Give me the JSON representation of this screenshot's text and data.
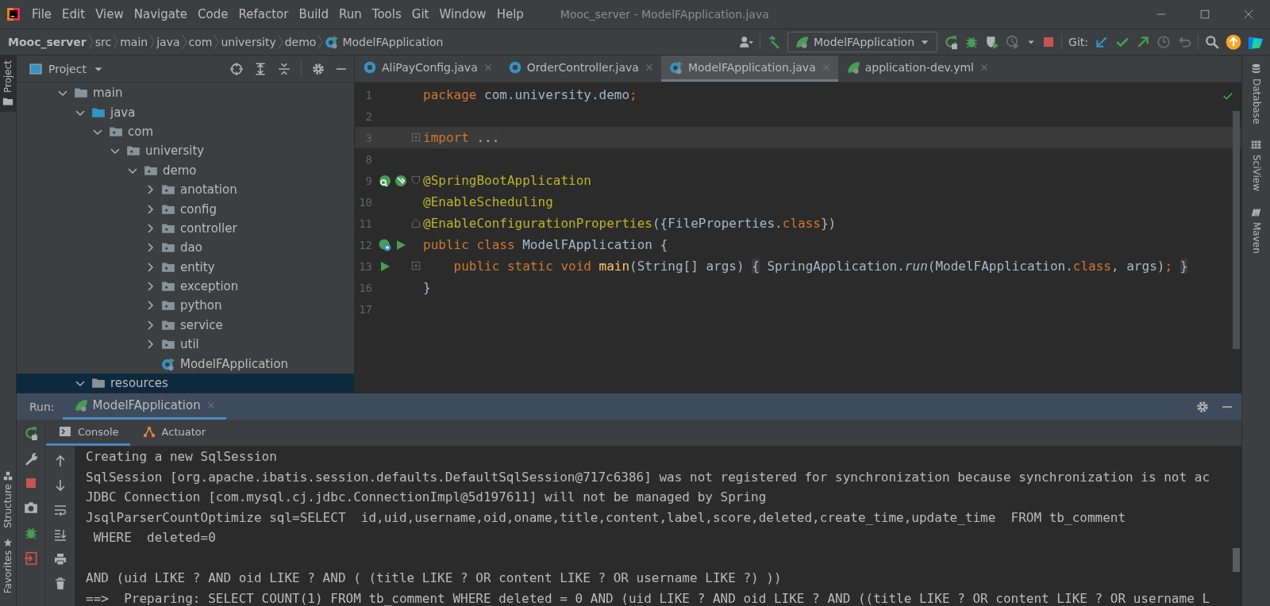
{
  "window": {
    "title": "Mooc_server - ModelFApplication.java"
  },
  "menu": [
    "File",
    "Edit",
    "View",
    "Navigate",
    "Code",
    "Refactor",
    "Build",
    "Run",
    "Tools",
    "Git",
    "Window",
    "Help"
  ],
  "breadcrumbs": [
    {
      "label": "Mooc_server",
      "kind": "project"
    },
    {
      "label": "src",
      "kind": "dir"
    },
    {
      "label": "main",
      "kind": "dir"
    },
    {
      "label": "java",
      "kind": "dir"
    },
    {
      "label": "com",
      "kind": "dir"
    },
    {
      "label": "university",
      "kind": "dir"
    },
    {
      "label": "demo",
      "kind": "dir"
    },
    {
      "label": "ModelFApplication",
      "kind": "class"
    }
  ],
  "toolbar": {
    "run_config": "ModelFApplication",
    "git_label": "Git:"
  },
  "left_stripe": [
    {
      "label": "Project",
      "kind": "project",
      "selected": true
    },
    {
      "label": "Structure",
      "kind": "structure",
      "selected": false
    },
    {
      "label": "Favorites",
      "kind": "favorites",
      "selected": false
    }
  ],
  "right_stripe": [
    {
      "label": "Database",
      "kind": "database"
    },
    {
      "label": "SciView",
      "kind": "grid"
    },
    {
      "label": "Maven",
      "kind": "maven"
    }
  ],
  "project_panel": {
    "title": "Project",
    "tree": [
      {
        "label": "main",
        "kind": "folder",
        "expanded": true,
        "selected": false,
        "children": [
          {
            "label": "java",
            "kind": "source-folder",
            "expanded": true,
            "selected": false,
            "children": [
              {
                "label": "com",
                "kind": "package",
                "expanded": true,
                "selected": false,
                "children": [
                  {
                    "label": "university",
                    "kind": "package",
                    "expanded": true,
                    "selected": false,
                    "children": [
                      {
                        "label": "demo",
                        "kind": "package",
                        "expanded": true,
                        "selected": false,
                        "children": [
                          {
                            "label": "anotation",
                            "kind": "package",
                            "expanded": false,
                            "selected": false
                          },
                          {
                            "label": "config",
                            "kind": "package",
                            "expanded": false,
                            "selected": false
                          },
                          {
                            "label": "controller",
                            "kind": "package",
                            "expanded": false,
                            "selected": false
                          },
                          {
                            "label": "dao",
                            "kind": "package",
                            "expanded": false,
                            "selected": false
                          },
                          {
                            "label": "entity",
                            "kind": "package",
                            "expanded": false,
                            "selected": false
                          },
                          {
                            "label": "exception",
                            "kind": "package",
                            "expanded": false,
                            "selected": false
                          },
                          {
                            "label": "python",
                            "kind": "package",
                            "expanded": false,
                            "selected": false
                          },
                          {
                            "label": "service",
                            "kind": "package",
                            "expanded": false,
                            "selected": false
                          },
                          {
                            "label": "util",
                            "kind": "package",
                            "expanded": false,
                            "selected": false
                          },
                          {
                            "label": "ModelFApplication",
                            "kind": "spring-class",
                            "selected": false
                          }
                        ]
                      }
                    ]
                  }
                ]
              }
            ]
          },
          {
            "label": "resources",
            "kind": "folder",
            "expanded": true,
            "selected": true
          }
        ]
      }
    ]
  },
  "editor": {
    "tabs": [
      {
        "label": "AliPayConfig.java",
        "kind": "class",
        "selected": false
      },
      {
        "label": "OrderController.java",
        "kind": "class",
        "selected": false
      },
      {
        "label": "ModelFApplication.java",
        "kind": "spring-class",
        "selected": true
      },
      {
        "label": "application-dev.yml",
        "kind": "yml",
        "selected": false
      }
    ],
    "lines": [
      {
        "number": "1",
        "current": false,
        "tokens": [
          {
            "text": "package",
            "kind": "keyword"
          },
          {
            "text": " com.university.demo",
            "kind": "text"
          },
          {
            "text": ";",
            "kind": "keyword"
          }
        ]
      },
      {
        "number": "2",
        "current": false
      },
      {
        "number": "3",
        "current": true,
        "fold": {
          "kind": "plus"
        },
        "tokens": [
          {
            "text": "import",
            "kind": "keyword"
          },
          {
            "text": "...",
            "kind": "folded"
          }
        ]
      },
      {
        "number": "8",
        "current": false
      },
      {
        "number": "9",
        "current": false,
        "fold": {
          "kind": "open"
        },
        "gutter": [
          {
            "kind": "bean"
          },
          {
            "kind": "implement"
          }
        ],
        "tokens": [
          {
            "text": "@SpringBootApplication",
            "kind": "annotation"
          }
        ]
      },
      {
        "number": "10",
        "current": false,
        "tokens": [
          {
            "text": "@EnableScheduling",
            "kind": "annotation"
          }
        ]
      },
      {
        "number": "11",
        "current": false,
        "fold": {
          "kind": "close"
        },
        "tokens": [
          {
            "text": "@EnableConfigurationProperties",
            "kind": "annotation"
          },
          {
            "text": "({FileProperties.",
            "kind": "text"
          },
          {
            "text": "class",
            "kind": "keyword"
          },
          {
            "text": "})",
            "kind": "text"
          }
        ]
      },
      {
        "number": "12",
        "current": false,
        "gutter": [
          {
            "kind": "spring"
          },
          {
            "kind": "run"
          }
        ],
        "tokens": [
          {
            "text": "public class ",
            "kind": "keyword"
          },
          {
            "text": "ModelFApplication {",
            "kind": "text"
          }
        ]
      },
      {
        "number": "13",
        "current": false,
        "fold": {
          "kind": "plus"
        },
        "gutter": [
          {
            "kind": "run"
          }
        ],
        "tokens": [
          {
            "text": "    public static void ",
            "kind": "keyword"
          },
          {
            "text": "main",
            "kind": "method"
          },
          {
            "text": "(String[] args)",
            "kind": "text"
          },
          {
            "text": "{",
            "kind": "folded"
          },
          {
            "text": " SpringApplication.",
            "kind": "text"
          },
          {
            "text": "run",
            "kind": "static-call"
          },
          {
            "text": "(ModelFApplication.",
            "kind": "text"
          },
          {
            "text": "class",
            "kind": "keyword"
          },
          {
            "text": ", args)",
            "kind": "text"
          },
          {
            "text": ";",
            "kind": "keyword"
          },
          {
            "text": "}",
            "kind": "folded"
          }
        ]
      },
      {
        "number": "16",
        "current": false,
        "tokens": [
          {
            "text": "}",
            "kind": "text"
          }
        ]
      },
      {
        "number": "17",
        "current": false
      }
    ]
  },
  "run_panel": {
    "label": "Run:",
    "tabs": [
      {
        "label": "ModelFApplication",
        "selected": true
      }
    ],
    "subtabs": [
      {
        "label": "Console",
        "kind": "console",
        "selected": true
      },
      {
        "label": "Actuator",
        "kind": "actuator",
        "selected": false
      }
    ],
    "console": [
      {
        "text": "Creating a new SqlSession",
        "blank_before": false
      },
      {
        "text": "SqlSession [org.apache.ibatis.session.defaults.DefaultSqlSession@717c6386] was not registered for synchronization because synchronization is not ac",
        "blank_before": false
      },
      {
        "text": "JDBC Connection [com.mysql.cj.jdbc.ConnectionImpl@5d197611] will not be managed by Spring",
        "blank_before": false
      },
      {
        "text": "JsqlParserCountOptimize sql=SELECT  id,uid,username,oid,oname,title,content,label,score,deleted,create_time,update_time  FROM tb_comment",
        "blank_before": false
      },
      {
        "text": " WHERE  deleted=0",
        "blank_before": false
      },
      {
        "text": "AND (uid LIKE ? AND oid LIKE ? AND ( (title LIKE ? OR content LIKE ? OR username LIKE ?) ))",
        "blank_before": true
      },
      {
        "text": "==>  Preparing: SELECT COUNT(1) FROM tb_comment WHERE deleted = 0 AND (uid LIKE ? AND oid LIKE ? AND ((title LIKE ? OR content LIKE ? OR username L",
        "blank_before": false
      }
    ]
  }
}
